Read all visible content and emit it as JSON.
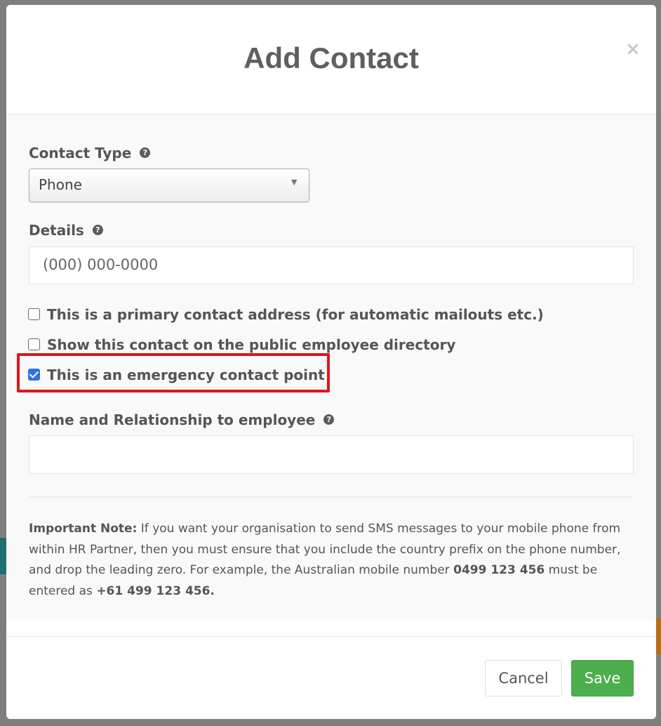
{
  "modal": {
    "title": "Add Contact",
    "close_glyph": "×"
  },
  "form": {
    "contact_type": {
      "label": "Contact Type",
      "help_glyph": "?",
      "selected_value": "Phone"
    },
    "details": {
      "label": "Details",
      "help_glyph": "?",
      "placeholder": "(000) 000-0000"
    },
    "checkboxes": [
      {
        "label": "This is a primary contact address (for automatic mailouts etc.)",
        "checked": false
      },
      {
        "label": "Show this contact on the public employee directory",
        "checked": false
      },
      {
        "label": "This is an emergency contact point",
        "checked": true
      }
    ],
    "name_relationship": {
      "label": "Name and Relationship to employee",
      "help_glyph": "?",
      "value": ""
    }
  },
  "note": {
    "heading": "Important Note:",
    "text_1": " If you want your organisation to send SMS messages to your mobile phone from within HR Partner, then you must ensure that you include the country prefix on the phone number, and drop the leading zero. For example, the Australian mobile number ",
    "example_local": "0499 123 456",
    "text_2": " must be entered as ",
    "example_intl": "+61 499 123 456."
  },
  "footer": {
    "cancel_label": "Cancel",
    "save_label": "Save"
  },
  "colors": {
    "highlight": "#e0141a",
    "save_button": "#4cae4c",
    "checkbox_checked": "#2d72e6"
  },
  "icons": {
    "help": "question-circle-icon",
    "close": "close-icon",
    "select": "caret-down-icon"
  }
}
